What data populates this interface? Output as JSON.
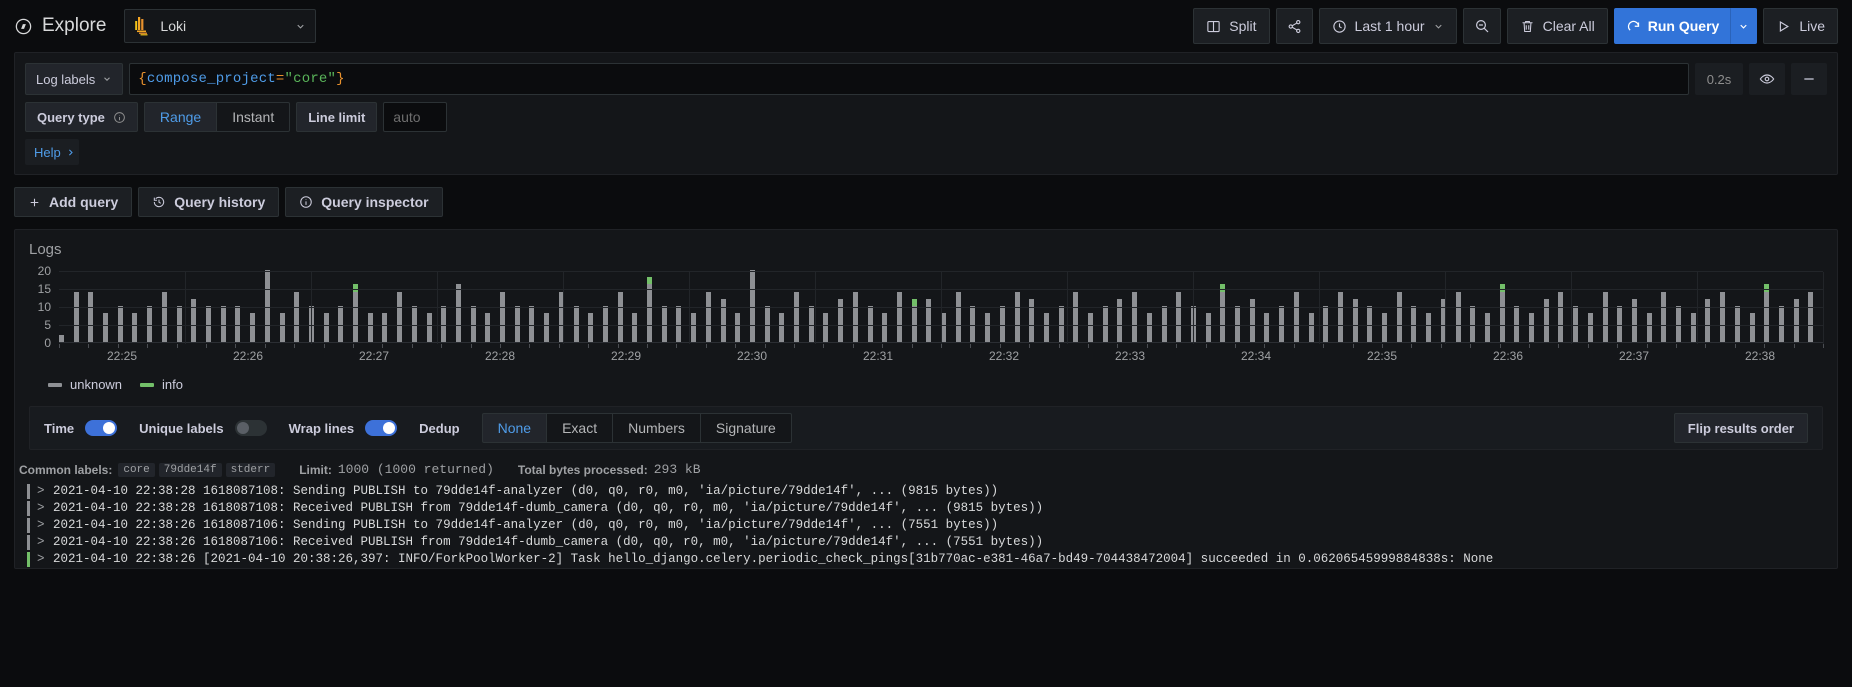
{
  "topbar": {
    "app_title": "Explore",
    "datasource": "Loki",
    "split_label": "Split",
    "share_icon": "share-icon",
    "time_range": "Last 1 hour",
    "zoom_out_icon": "zoom-out-icon",
    "clear_all_label": "Clear All",
    "run_query_label": "Run Query",
    "live_label": "Live"
  },
  "query": {
    "log_labels_label": "Log labels",
    "expr_open_brace": "{",
    "expr_label": "compose_project",
    "expr_eq": "=",
    "expr_value": "\"core\"",
    "expr_close_brace": "}",
    "timing": "0.2s",
    "eye_icon": "eye-icon",
    "remove_icon": "minus-icon",
    "query_type_label": "Query type",
    "query_type_options": [
      "Range",
      "Instant"
    ],
    "query_type_selected": "Range",
    "line_limit_label": "Line limit",
    "line_limit_placeholder": "auto",
    "line_limit_value": "",
    "help_label": "Help"
  },
  "actions": {
    "add_query": "Add query",
    "query_history": "Query history",
    "query_inspector": "Query inspector"
  },
  "logs_panel": {
    "title": "Logs",
    "flip_results_order": "Flip results order"
  },
  "controls": {
    "time_label": "Time",
    "time_on": true,
    "unique_labels_label": "Unique labels",
    "unique_labels_on": false,
    "wrap_lines_label": "Wrap lines",
    "wrap_lines_on": true,
    "dedup_label": "Dedup",
    "dedup_options": [
      "None",
      "Exact",
      "Numbers",
      "Signature"
    ],
    "dedup_selected": "None"
  },
  "meta": {
    "common_labels_label": "Common labels:",
    "common_labels": [
      "core",
      "79dde14f",
      "stderr"
    ],
    "limit_label": "Limit:",
    "limit_value": "1000 (1000 returned)",
    "bytes_label": "Total bytes processed:",
    "bytes_value": "293 kB"
  },
  "log_rows": [
    {
      "level": "unknown",
      "text": "2021-04-10 22:38:28 1618087108: Sending PUBLISH to 79dde14f-analyzer (d0, q0, r0, m0, 'ia/picture/79dde14f', ... (9815 bytes))"
    },
    {
      "level": "unknown",
      "text": "2021-04-10 22:38:28 1618087108: Received PUBLISH from 79dde14f-dumb_camera (d0, q0, r0, m0, 'ia/picture/79dde14f', ... (9815 bytes))"
    },
    {
      "level": "unknown",
      "text": "2021-04-10 22:38:26 1618087106: Sending PUBLISH to 79dde14f-analyzer (d0, q0, r0, m0, 'ia/picture/79dde14f', ... (7551 bytes))"
    },
    {
      "level": "unknown",
      "text": "2021-04-10 22:38:26 1618087106: Received PUBLISH from 79dde14f-dumb_camera (d0, q0, r0, m0, 'ia/picture/79dde14f', ... (7551 bytes))"
    },
    {
      "level": "info",
      "text": "2021-04-10 22:38:26 [2021-04-10 20:38:26,397: INFO/ForkPoolWorker-2] Task hello_django.celery.periodic_check_pings[31b770ac-e381-46a7-bd49-704438472004] succeeded in 0.06206545999884838s: None"
    }
  ],
  "colors": {
    "accent_blue": "#3274d9",
    "link_blue": "#4f9ce8",
    "unknown_gray": "#8e9094",
    "info_green": "#73bf69",
    "panel_bg": "#141619",
    "page_bg": "#0b0c0e"
  },
  "chart_data": {
    "type": "bar",
    "title": "Logs",
    "xlabel": "",
    "ylabel": "",
    "ylim": [
      0,
      20
    ],
    "yticks": [
      0,
      5,
      10,
      15,
      20
    ],
    "grid": true,
    "legend_position": "bottom-left",
    "stacked": true,
    "legend": [
      "unknown",
      "info"
    ],
    "series_colors": {
      "unknown": "#8e9094",
      "info": "#73bf69"
    },
    "xtick_labels": [
      "22:25",
      "22:26",
      "22:27",
      "22:28",
      "22:29",
      "22:30",
      "22:31",
      "22:32",
      "22:33",
      "22:34",
      "22:35",
      "22:36",
      "22:37",
      "22:38"
    ],
    "series": [
      {
        "name": "unknown",
        "values": [
          2,
          14,
          14,
          8,
          10,
          8,
          10,
          14,
          10,
          12,
          10,
          10,
          10,
          8,
          20,
          8,
          14,
          10,
          8,
          10,
          14,
          8,
          8,
          14,
          10,
          8,
          10,
          16,
          10,
          8,
          14,
          10,
          10,
          8,
          14,
          10,
          8,
          10,
          14,
          8,
          16,
          10,
          10,
          8,
          14,
          12,
          8,
          20,
          10,
          8,
          14,
          10,
          8,
          12,
          14,
          10,
          8,
          14,
          10,
          12,
          8,
          14,
          10,
          8,
          10,
          14,
          12,
          8,
          10,
          14,
          8,
          10,
          12,
          14,
          8,
          10,
          14,
          10,
          8,
          14,
          10,
          12,
          8,
          10,
          14,
          8,
          10,
          14,
          12,
          10,
          8,
          14,
          10,
          8,
          12,
          14,
          10,
          8,
          14,
          10,
          8,
          12,
          14,
          10,
          8,
          14,
          10,
          12,
          8,
          14,
          10,
          8,
          12,
          14,
          10,
          8,
          14,
          10,
          12,
          14
        ]
      },
      {
        "name": "info",
        "values": [
          0,
          0,
          0,
          0,
          0,
          0,
          0,
          0,
          0,
          0,
          0,
          0,
          0,
          0,
          0,
          0,
          0,
          0,
          0,
          0,
          2,
          0,
          0,
          0,
          0,
          0,
          0,
          0,
          0,
          0,
          0,
          0,
          0,
          0,
          0,
          0,
          0,
          0,
          0,
          0,
          2,
          0,
          0,
          0,
          0,
          0,
          0,
          0,
          0,
          0,
          0,
          0,
          0,
          0,
          0,
          0,
          0,
          0,
          2,
          0,
          0,
          0,
          0,
          0,
          0,
          0,
          0,
          0,
          0,
          0,
          0,
          0,
          0,
          0,
          0,
          0,
          0,
          0,
          0,
          2,
          0,
          0,
          0,
          0,
          0,
          0,
          0,
          0,
          0,
          0,
          0,
          0,
          0,
          0,
          0,
          0,
          0,
          0,
          2,
          0,
          0,
          0,
          0,
          0,
          0,
          0,
          0,
          0,
          0,
          0,
          0,
          0,
          0,
          0,
          0,
          0,
          2,
          0,
          0,
          0
        ]
      }
    ]
  }
}
